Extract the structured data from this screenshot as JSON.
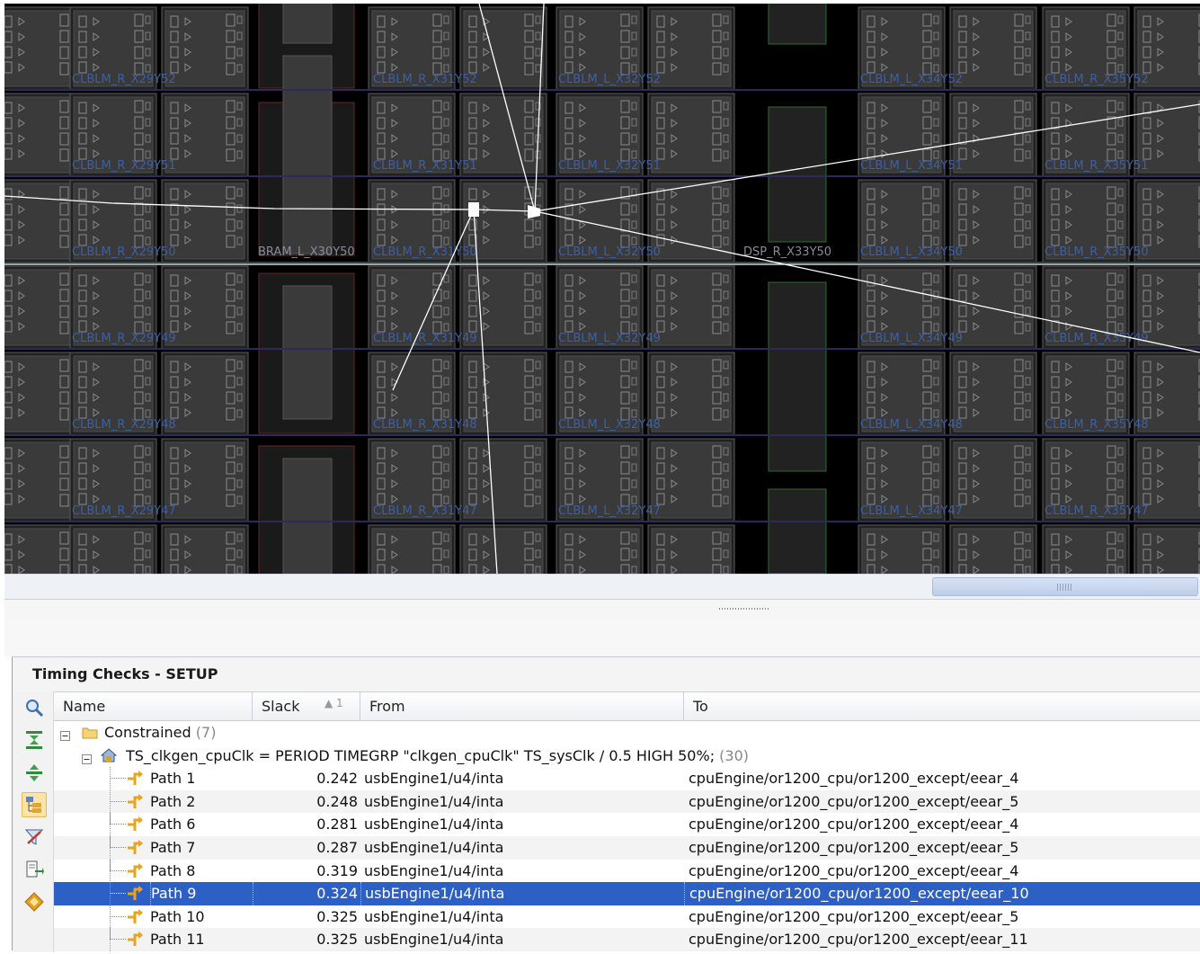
{
  "device_view": {
    "columns": [
      {
        "kind": "CLBLM",
        "coord": "X29"
      },
      {
        "kind": "BRAM",
        "coord": "X30"
      },
      {
        "kind": "CLBLM",
        "coord": "X31"
      },
      {
        "kind": "CLBLM",
        "coord": "X32"
      },
      {
        "kind": "DSP",
        "coord": "X33"
      },
      {
        "kind": "CLBLM",
        "coord": "X34"
      },
      {
        "kind": "CLBLM",
        "coord": "X35"
      }
    ],
    "rows": [
      "Y52",
      "Y51",
      "Y50",
      "Y49",
      "Y48",
      "Y47"
    ],
    "labels": {
      "r0": [
        "CLBLM_R_X29Y52",
        "CLBLM_R_X31Y52",
        "CLBLM_L_X32Y52",
        "CLBLM_L_X34Y52",
        "CLBLM_R_X35Y52"
      ],
      "r1": [
        "CLBLM_R_X29Y51",
        "CLBLM_R_X31Y51",
        "CLBLM_L_X32Y51",
        "CLBLM_L_X34Y51",
        "CLBLM_R_X35Y51"
      ],
      "r2": [
        "CLBLM_R_X29Y50",
        "CLBLM_R_X31Y50",
        "CLBLM_L_X32Y50",
        "CLBLM_L_X34Y50",
        "CLBLM_R_X35Y50"
      ],
      "r3": [
        "CLBLM_R_X29Y49",
        "CLBLM_R_X31Y49",
        "CLBLM_L_X32Y49",
        "CLBLM_L_X34Y49",
        "CLBLM_R_X35Y49"
      ],
      "r4": [
        "CLBLM_R_X29Y48",
        "CLBLM_R_X31Y48",
        "CLBLM_L_X32Y48",
        "CLBLM_L_X34Y48",
        "CLBLM_R_X35Y48"
      ],
      "r5": [
        "CLBLM_R_X29Y47",
        "CLBLM_R_X31Y47",
        "CLBLM_L_X32Y47",
        "CLBLM_L_X34Y47",
        "CLBLM_R_X35Y47"
      ]
    },
    "bram_label": "BRAM_L_X30Y50",
    "dsp_label": "DSP_R_X33Y50",
    "colors": {
      "background": "#000000",
      "tile": "#3a3a3a",
      "tile_border": "#5b5b5b",
      "label": "#3f5f9f",
      "net": "#ffffff",
      "bram_accent": "#6a2525",
      "dsp_accent": "#2f6a2f"
    }
  },
  "panel": {
    "title": "Timing Checks - SETUP"
  },
  "toolbar": {
    "icons": [
      "search-icon",
      "expand-all-icon",
      "collapse-all-icon",
      "group-by-constraint-icon",
      "clear-filter-icon",
      "export-icon",
      "report-icon"
    ]
  },
  "table": {
    "columns": {
      "name": "Name",
      "slack": "Slack",
      "slack_sort": "▲ 1",
      "from": "From",
      "to": "To"
    },
    "group": {
      "label": "Constrained",
      "count": "(7)"
    },
    "constraint": {
      "label": "TS_clkgen_cpuClk = PERIOD TIMEGRP \"clkgen_cpuClk\" TS_sysClk / 0.5 HIGH 50%;",
      "count": "(30)"
    },
    "rows": [
      {
        "name": "Path 1",
        "slack": "0.242",
        "from": "usbEngine1/u4/inta",
        "to": "cpuEngine/or1200_cpu/or1200_except/eear_4"
      },
      {
        "name": "Path 2",
        "slack": "0.248",
        "from": "usbEngine1/u4/inta",
        "to": "cpuEngine/or1200_cpu/or1200_except/eear_5"
      },
      {
        "name": "Path 6",
        "slack": "0.281",
        "from": "usbEngine1/u4/inta",
        "to": "cpuEngine/or1200_cpu/or1200_except/eear_4"
      },
      {
        "name": "Path 7",
        "slack": "0.287",
        "from": "usbEngine1/u4/inta",
        "to": "cpuEngine/or1200_cpu/or1200_except/eear_5"
      },
      {
        "name": "Path 8",
        "slack": "0.319",
        "from": "usbEngine1/u4/inta",
        "to": "cpuEngine/or1200_cpu/or1200_except/eear_4"
      },
      {
        "name": "Path 9",
        "slack": "0.324",
        "from": "usbEngine1/u4/inta",
        "to": "cpuEngine/or1200_cpu/or1200_except/eear_10"
      },
      {
        "name": "Path 10",
        "slack": "0.325",
        "from": "usbEngine1/u4/inta",
        "to": "cpuEngine/or1200_cpu/or1200_except/eear_5"
      },
      {
        "name": "Path 11",
        "slack": "0.325",
        "from": "usbEngine1/u4/inta",
        "to": "cpuEngine/or1200_cpu/or1200_except/eear_11"
      }
    ],
    "selected_row": "Path 9",
    "colors": {
      "selection": "#2d60c4",
      "alt_row": "#f3f3f3",
      "path_icon": "#e7a321"
    }
  }
}
